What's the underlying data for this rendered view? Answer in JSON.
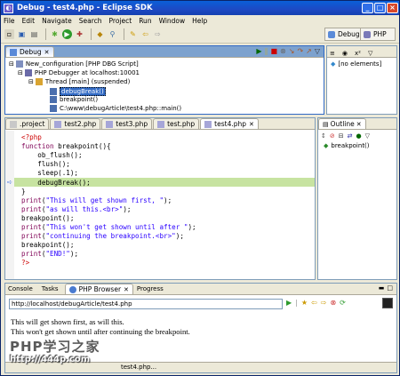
{
  "window": {
    "title": "Debug - test4.php - Eclipse SDK",
    "minimize": "_",
    "maximize": "□",
    "close": "×"
  },
  "menu": [
    "File",
    "Edit",
    "Navigate",
    "Search",
    "Project",
    "Run",
    "Window",
    "Help"
  ],
  "perspectives": [
    {
      "label": "Debug"
    },
    {
      "label": "PHP"
    }
  ],
  "debug_view": {
    "tab": "Debug",
    "tree": [
      "New_configuration [PHP DBG Script]",
      "PHP Debugger at localhost:10001",
      "Thread [main] (suspended)",
      "debugBreak()",
      "breakpoint()",
      "C:\\www\\debugArticle\\test4.php::main()"
    ]
  },
  "variables_view": {
    "empty": "[no elements]"
  },
  "editor": {
    "tabs": [
      ".project",
      "test2.php",
      "test3.php",
      "test.php",
      "test4.php"
    ],
    "active_tab": "test4.php"
  },
  "outline": {
    "tab": "Outline",
    "items": [
      "breakpoint()"
    ]
  },
  "bottom": {
    "tabs": [
      "Console",
      "Tasks",
      "PHP Browser",
      "Progress"
    ],
    "active_tab": "PHP Browser",
    "url": "http://localhost/debugArticle/test4.php",
    "output_line1": "This will get shown first, as will this.",
    "output_line2": "This won't get shown until after continuing the breakpoint.",
    "status": "test4.php..."
  },
  "watermark": {
    "line1": "PHP学习之家",
    "line2": "http://444p.com"
  }
}
